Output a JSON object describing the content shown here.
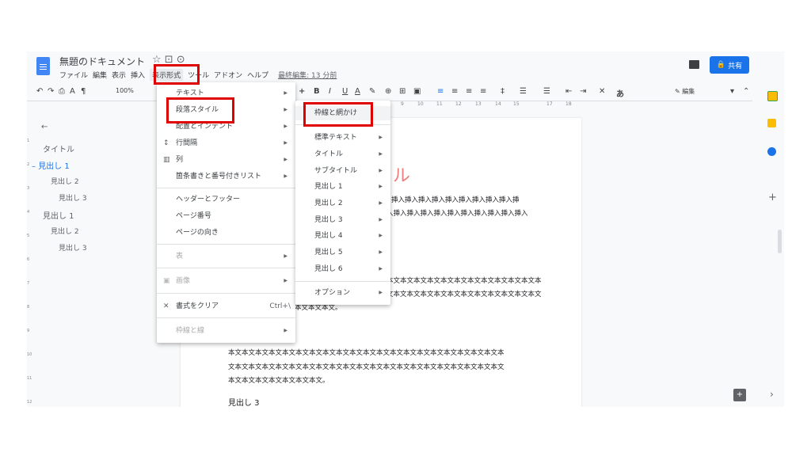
{
  "doc": {
    "title": "無題のドキュメント",
    "menus": [
      "ファイル",
      "編集",
      "表示",
      "挿入",
      "表示形式",
      "ツール",
      "アドオン",
      "ヘルプ"
    ],
    "last_edit": "最終編集: 13 分前",
    "share_label": "共有",
    "zoom": "100%",
    "mode": "編集"
  },
  "outline": [
    "タイトル",
    "見出し 1",
    "見出し 2",
    "見出し 3",
    "見出し 1",
    "見出し 2",
    "見出し 3"
  ],
  "format_menu": {
    "items": [
      {
        "label": "テキスト",
        "submenu": true
      },
      {
        "label": "段落スタイル",
        "submenu": true
      },
      {
        "label": "配置とインデント",
        "submenu": true
      },
      {
        "label": "行間隔",
        "submenu": true
      },
      {
        "label": "列",
        "submenu": true
      },
      {
        "label": "箇条書きと番号付きリスト",
        "submenu": true
      },
      {
        "label": "ヘッダーとフッター"
      },
      {
        "label": "ページ番号"
      },
      {
        "label": "ページの向き"
      },
      {
        "label": "表",
        "submenu": true
      },
      {
        "label": "画像",
        "submenu": true
      },
      {
        "label": "書式をクリア",
        "shortcut": "Ctrl+\\"
      },
      {
        "label": "枠線と線",
        "submenu": true
      }
    ]
  },
  "paragraph_menu": {
    "items": [
      "枠線と網かけ",
      "標準テキスト",
      "タイトル",
      "サブタイトル",
      "見出し 1",
      "見出し 2",
      "見出し 3",
      "見出し 4",
      "見出し 5",
      "見出し 6",
      "オプション"
    ]
  },
  "body": {
    "title_partial": "ル",
    "insert_line1": "挿入挿入挿入挿入挿入挿入挿入挿入挿入挿",
    "insert_line2": "入挿入挿入挿入挿入挿入挿入挿入挿入挿入挿入",
    "text_line1": "本文本文本文本文本文本文本文本文本文本文本文本",
    "text_line2": "文本文本文本文本文本文本文本文本文本文本文本文",
    "text_line3": "本文本文本文。",
    "para2_line1": "本文本文本文本文本文本文本文本文本文本文本文本文本文本文本文本文本文本文本文本文本",
    "para2_line2": "文本文本文本文本文本文本文本文本文本文本文本文本文本文本文本文本文本文本文本文本文",
    "para2_line3": "本文本文本文本文本文本文本文。",
    "heading3": "見出し 3"
  },
  "ruler_ticks": [
    "9",
    "10",
    "11",
    "12",
    "13",
    "14",
    "15",
    "17",
    "18"
  ]
}
